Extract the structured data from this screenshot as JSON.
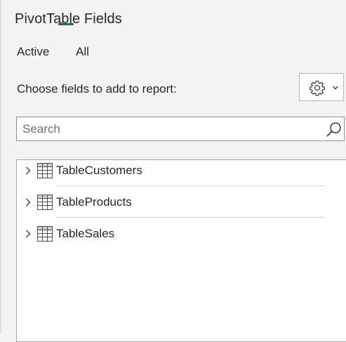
{
  "pane": {
    "title": "PivotTable Fields"
  },
  "tabs": [
    {
      "label": "Active"
    },
    {
      "label": "All",
      "selected": true
    }
  ],
  "choose_label": "Choose fields to add to report:",
  "settings": {
    "icon": "gear-icon",
    "dropdown_icon": "chevron-down-icon"
  },
  "search": {
    "placeholder": "Search",
    "value": "",
    "icon": "search-icon"
  },
  "fields": [
    {
      "label": "TableCustomers",
      "icon": "table-icon",
      "expanded": false
    },
    {
      "label": "TableProducts",
      "icon": "table-icon",
      "expanded": false
    },
    {
      "label": "TableSales",
      "icon": "table-icon",
      "expanded": false
    }
  ],
  "colors": {
    "accent": "#217346",
    "background": "#f3f3f3",
    "text": "#262626"
  }
}
